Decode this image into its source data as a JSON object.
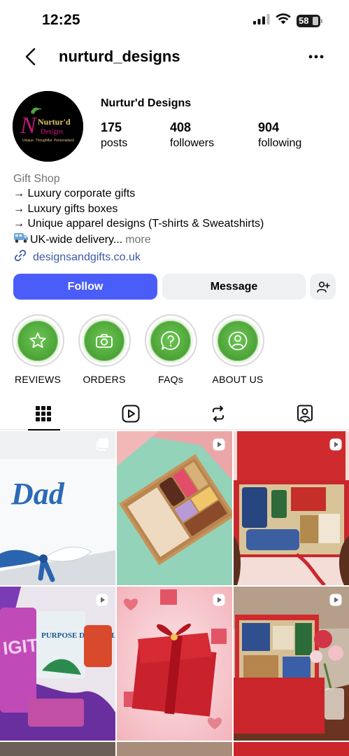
{
  "status_bar": {
    "time": "12:25",
    "battery": "58"
  },
  "header": {
    "username": "nurturd_designs"
  },
  "profile": {
    "display_name": "Nurtur'd Designs",
    "logo": {
      "main": "Nurtur'd",
      "sub": "Designs",
      "tagline": "Unique. Thoughtful. Personalised"
    },
    "stats": [
      {
        "value": "175",
        "label": "posts"
      },
      {
        "value": "408",
        "label": "followers"
      },
      {
        "value": "904",
        "label": "following"
      }
    ]
  },
  "bio": {
    "category": "Gift Shop",
    "lines": [
      "→ Luxury corporate gifts",
      "→ Luxury gifts boxes",
      "→ Unique apparel designs (T-shirts & Sweatshirts)",
      "UK-wide delivery..."
    ],
    "more_label": "more",
    "link": "designsandgifts.co.uk"
  },
  "actions": {
    "follow_label": "Follow",
    "message_label": "Message"
  },
  "highlights": [
    {
      "label": "REVIEWS",
      "icon": "star-icon"
    },
    {
      "label": "ORDERS",
      "icon": "camera-icon"
    },
    {
      "label": "FAQs",
      "icon": "question-icon"
    },
    {
      "label": "ABOUT US",
      "icon": "person-icon"
    }
  ],
  "tabs": [
    {
      "icon": "grid-icon",
      "active": true
    },
    {
      "icon": "reels-icon",
      "active": false
    },
    {
      "icon": "reposts-icon",
      "active": false
    },
    {
      "icon": "tagged-icon",
      "active": false
    }
  ],
  "posts": [
    {
      "type": "carousel",
      "text": "Dad"
    },
    {
      "type": "reel",
      "text": ""
    },
    {
      "type": "reel",
      "text": ""
    },
    {
      "type": "reel",
      "text": "PURPOSE DRIVEN LIFE"
    },
    {
      "type": "reel",
      "text": ""
    },
    {
      "type": "reel",
      "text": ""
    }
  ],
  "colors": {
    "accent": "#4a5df9",
    "link": "#3c5aa6",
    "highlight_green": "#4fa73a",
    "brand_magenta": "#c0187a"
  }
}
